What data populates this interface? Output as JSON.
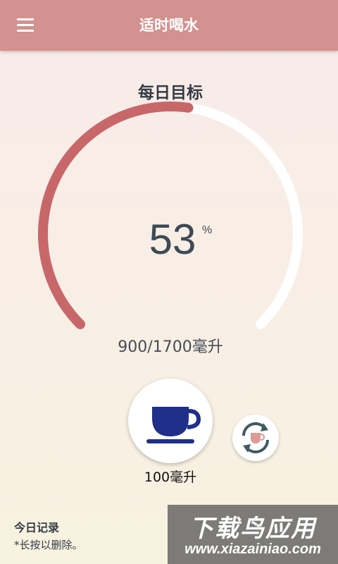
{
  "app": {
    "title": "适时喝水"
  },
  "goal": {
    "title": "每日目标",
    "percent": "53",
    "percent_sign": "%",
    "progress_fraction": 0.53,
    "amount_text": "900/1700毫升"
  },
  "drink": {
    "cup_label": "100毫升"
  },
  "records": {
    "title": "今日记录",
    "hint": "*长按以删除。"
  },
  "watermark": {
    "main": "下载鸟应用",
    "url": "www.xiazainiao.com"
  },
  "colors": {
    "appbar": "#d3918f",
    "progress": "#c8676a",
    "track": "#ffffff",
    "cup": "#1f2f8a",
    "text": "#3e4a56"
  },
  "icons": {
    "menu": "hamburger-menu-icon",
    "cup": "coffee-cup-icon",
    "switch": "refresh-cup-icon"
  }
}
